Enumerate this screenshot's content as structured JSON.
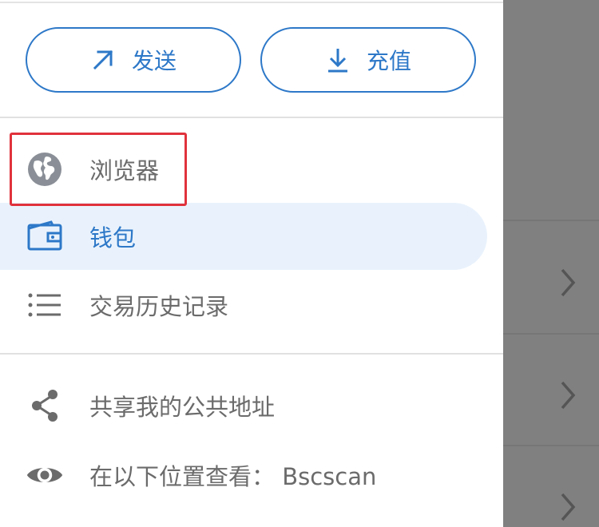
{
  "actions": {
    "send_label": "发送",
    "deposit_label": "充值"
  },
  "menu": {
    "items": [
      {
        "label": "浏览器",
        "icon": "globe-icon",
        "active": false
      },
      {
        "label": "钱包",
        "icon": "wallet-icon",
        "active": true
      },
      {
        "label": "交易历史记录",
        "icon": "list-icon",
        "active": false
      }
    ],
    "secondary": [
      {
        "label": "共享我的公共地址",
        "icon": "share-icon"
      },
      {
        "label": "在以下位置查看： Bscscan",
        "icon": "eye-icon"
      }
    ]
  },
  "colors": {
    "accent": "#2d78c8",
    "active_bg": "#e9f2fc",
    "text_muted": "#6b6b6b",
    "highlight": "#e0323c",
    "overlay": "#808080"
  }
}
